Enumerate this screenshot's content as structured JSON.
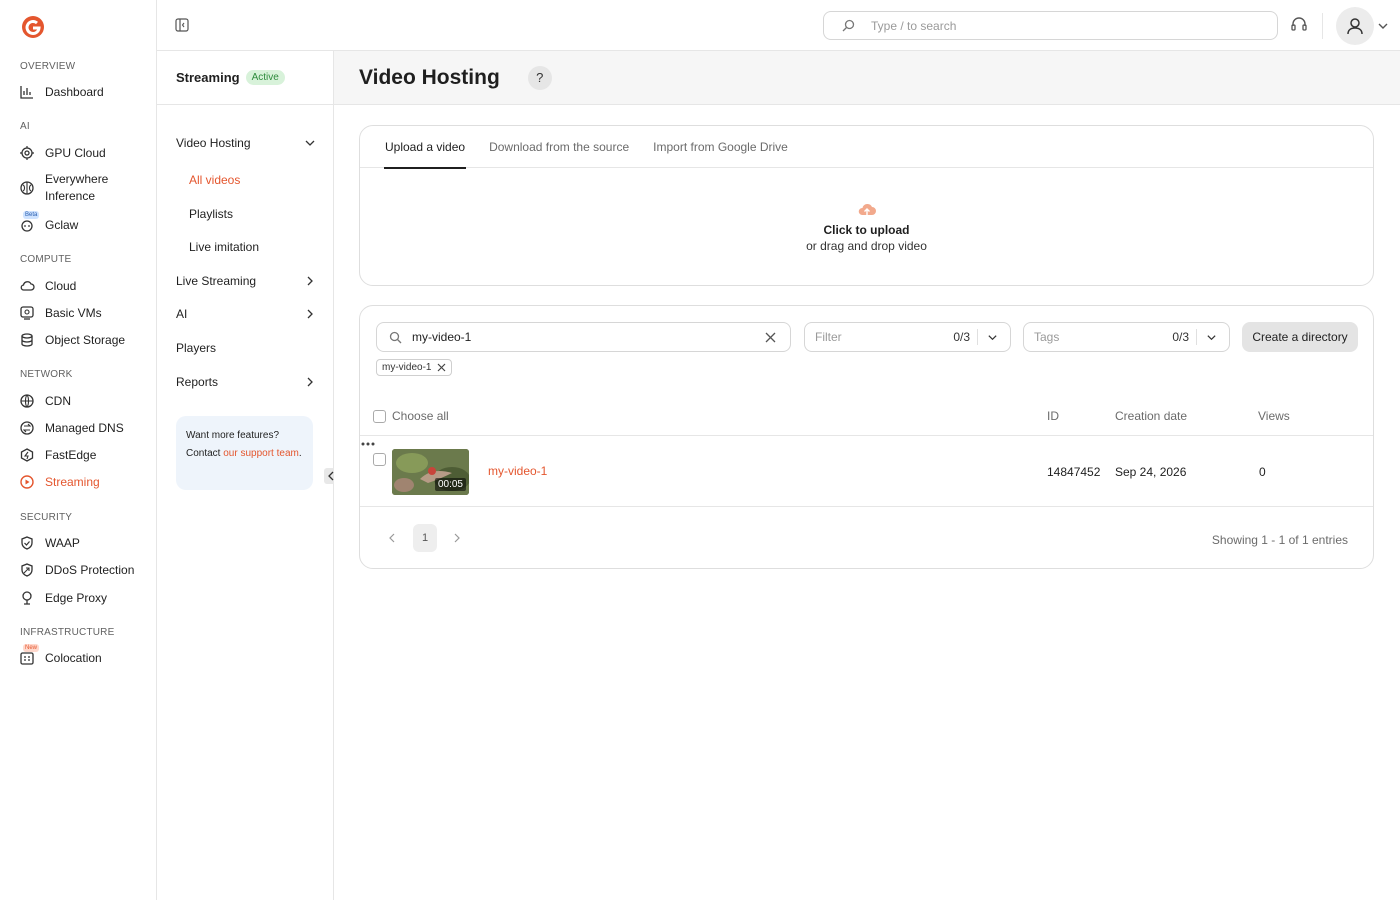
{
  "nav": {
    "sections": [
      {
        "title": "OVERVIEW",
        "items": [
          {
            "label": "Dashboard",
            "icon": "chart-icon"
          }
        ]
      },
      {
        "title": "AI",
        "items": [
          {
            "label": "GPU Cloud",
            "icon": "gpu-icon"
          },
          {
            "label": "Everywhere Inference",
            "icon": "brain-icon"
          },
          {
            "label": "Gclaw",
            "icon": "robot-icon",
            "badge": "Beta"
          }
        ]
      },
      {
        "title": "COMPUTE",
        "items": [
          {
            "label": "Cloud",
            "icon": "cloud-icon"
          },
          {
            "label": "Basic VMs",
            "icon": "vm-icon"
          },
          {
            "label": "Object Storage",
            "icon": "database-icon"
          }
        ]
      },
      {
        "title": "NETWORK",
        "items": [
          {
            "label": "CDN",
            "icon": "globe-icon"
          },
          {
            "label": "Managed DNS",
            "icon": "dns-icon"
          },
          {
            "label": "FastEdge",
            "icon": "fastedge-icon"
          },
          {
            "label": "Streaming",
            "icon": "streaming-icon"
          }
        ]
      },
      {
        "title": "SECURITY",
        "items": [
          {
            "label": "WAAP",
            "icon": "shield-icon"
          },
          {
            "label": "DDoS Protection",
            "icon": "ddos-icon"
          },
          {
            "label": "Edge Proxy",
            "icon": "proxy-icon"
          }
        ]
      },
      {
        "title": "INFRASTRUCTURE",
        "items": [
          {
            "label": "Colocation",
            "icon": "building-icon",
            "badge": "New"
          }
        ]
      }
    ]
  },
  "topbar": {
    "search_placeholder": "Type / to search"
  },
  "subnav": {
    "title": "Streaming",
    "status": "Active",
    "items": {
      "video_hosting": "Video Hosting",
      "all_videos": "All videos",
      "playlists": "Playlists",
      "live_imitation": "Live imitation",
      "live_streaming": "Live Streaming",
      "ai": "AI",
      "players": "Players",
      "reports": "Reports"
    },
    "promo": {
      "line1": "Want more features?",
      "contact": "Contact ",
      "link": "our support team",
      "end": "."
    }
  },
  "page": {
    "title": "Video Hosting",
    "help": "?"
  },
  "upload": {
    "tabs": [
      "Upload a video",
      "Download from the source",
      "Import from Google Drive"
    ],
    "title": "Click to upload",
    "subtitle": "or drag and drop video"
  },
  "list": {
    "search_value": "my-video-1",
    "filter": {
      "placeholder": "Filter",
      "count": "0/3"
    },
    "tags": {
      "placeholder": "Tags",
      "count": "0/3"
    },
    "create_dir": "Create a directory",
    "chip": "my-video-1",
    "headers": {
      "choose_all": "Choose all",
      "id": "ID",
      "date": "Creation date",
      "views": "Views"
    },
    "rows": [
      {
        "name": "my-video-1",
        "duration": "00:05",
        "id": "14847452",
        "date": "Sep 24, 2026",
        "views": "0"
      }
    ],
    "pagination": {
      "current": "1",
      "showing": "Showing 1 - 1 of 1 entries"
    }
  },
  "colors": {
    "accent": "#e4562e",
    "active_badge_bg": "#d8f2da",
    "active_badge_text": "#2e8b3c"
  }
}
